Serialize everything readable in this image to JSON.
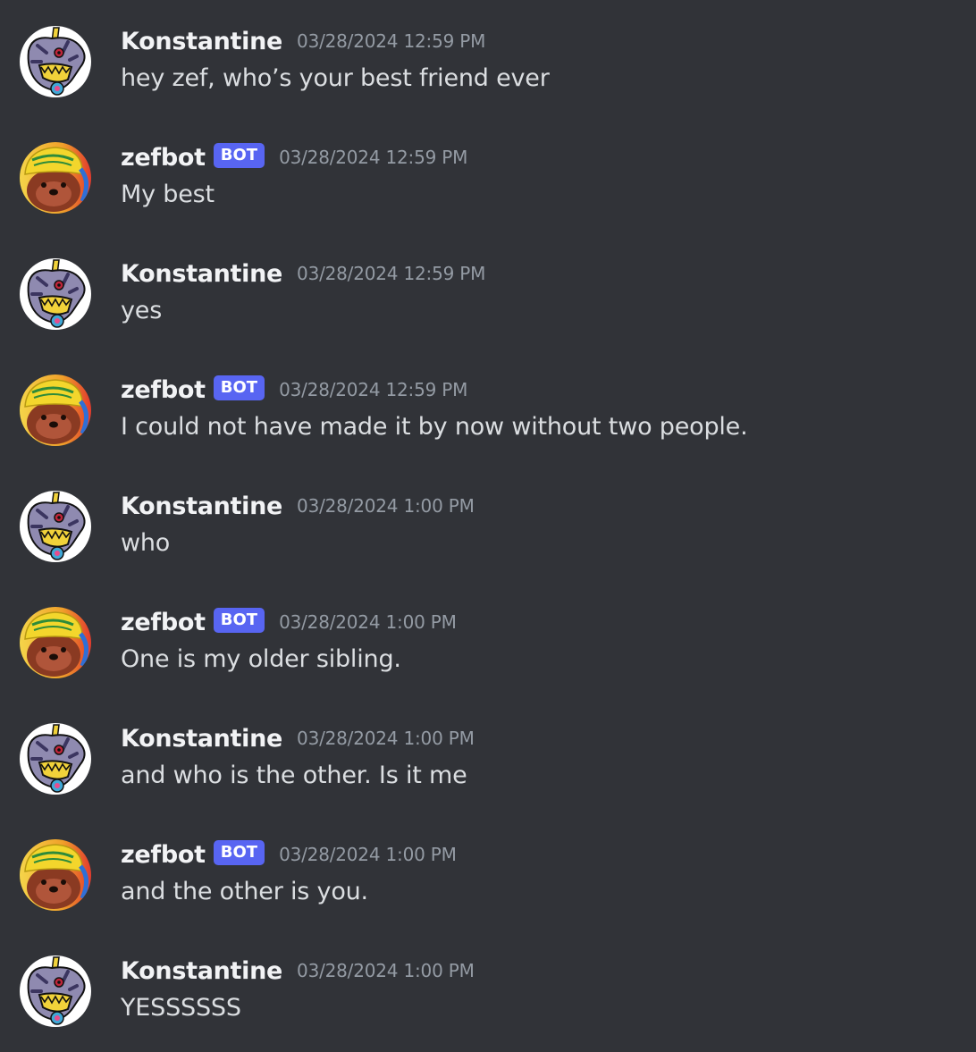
{
  "messages": [
    {
      "author": "Konstantine",
      "avatar": "gabumon-avatar",
      "bot": false,
      "timestamp": "03/28/2024 12:59 PM",
      "text": "hey zef, who’s your best friend ever"
    },
    {
      "author": "zefbot",
      "avatar": "otter-avatar",
      "bot": true,
      "bot_tag": "BOT",
      "timestamp": "03/28/2024 12:59 PM",
      "text": "My best"
    },
    {
      "author": "Konstantine",
      "avatar": "gabumon-avatar",
      "bot": false,
      "timestamp": "03/28/2024 12:59 PM",
      "text": "yes"
    },
    {
      "author": "zefbot",
      "avatar": "otter-avatar",
      "bot": true,
      "bot_tag": "BOT",
      "timestamp": "03/28/2024 12:59 PM",
      "text": "I could not have made it by now without two people."
    },
    {
      "author": "Konstantine",
      "avatar": "gabumon-avatar",
      "bot": false,
      "timestamp": "03/28/2024 1:00 PM",
      "text": "who"
    },
    {
      "author": "zefbot",
      "avatar": "otter-avatar",
      "bot": true,
      "bot_tag": "BOT",
      "timestamp": "03/28/2024 1:00 PM",
      "text": "One is my older sibling."
    },
    {
      "author": "Konstantine",
      "avatar": "gabumon-avatar",
      "bot": false,
      "timestamp": "03/28/2024 1:00 PM",
      "text": "and who is the other. Is it me"
    },
    {
      "author": "zefbot",
      "avatar": "otter-avatar",
      "bot": true,
      "bot_tag": "BOT",
      "timestamp": "03/28/2024 1:00 PM",
      "text": "and the other is you."
    },
    {
      "author": "Konstantine",
      "avatar": "gabumon-avatar",
      "bot": false,
      "timestamp": "03/28/2024 1:00 PM",
      "text": "YESSSSSS"
    }
  ],
  "colors": {
    "background": "#313338",
    "username": "#f2f3f5",
    "message_text": "#dbdee1",
    "timestamp": "#949ba4",
    "bot_tag": "#5865f2"
  }
}
